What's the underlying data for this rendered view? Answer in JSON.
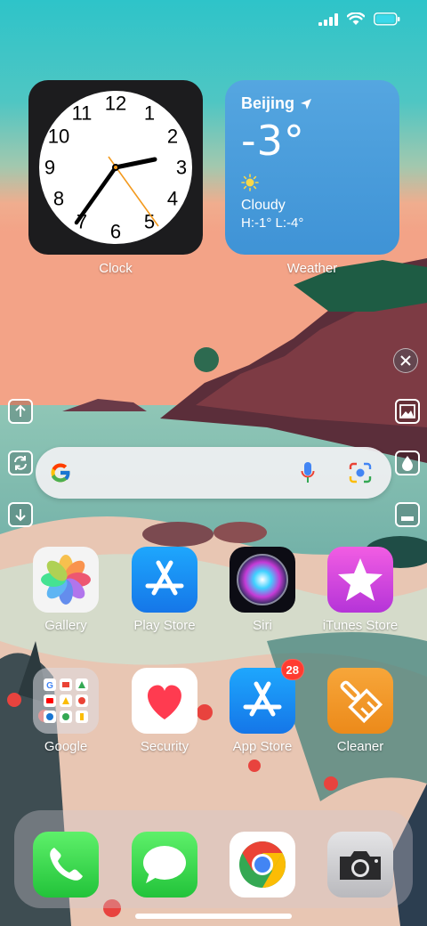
{
  "widgets": {
    "clock": {
      "label": "Clock",
      "numbers": [
        "12",
        "1",
        "2",
        "3",
        "4",
        "5",
        "6",
        "7",
        "8",
        "9",
        "10",
        "11"
      ]
    },
    "weather": {
      "label": "Weather",
      "city": "Beijing",
      "temperature": "-3°",
      "condition": "Cloudy",
      "hilo": "H:-1° L:-4°"
    }
  },
  "search": {
    "provider": "Google",
    "icons": [
      "google-g-icon",
      "microphone-icon",
      "lens-camera-icon"
    ]
  },
  "side_tools": [
    "arrow-up-icon",
    "rotate-icon",
    "arrow-down-icon",
    "image-icon",
    "water-drop-icon",
    "bottom-bar-icon",
    "close-icon"
  ],
  "apps_row1": [
    {
      "label": "Gallery",
      "icon": "photos-flower-icon"
    },
    {
      "label": "Play Store",
      "icon": "app-store-a-icon"
    },
    {
      "label": "Siri",
      "icon": "siri-orb-icon"
    },
    {
      "label": "iTunes Store",
      "icon": "star-icon"
    }
  ],
  "apps_row2": [
    {
      "label": "Google",
      "icon": "folder-icon"
    },
    {
      "label": "Security",
      "icon": "heart-icon"
    },
    {
      "label": "App Store",
      "icon": "app-store-a-icon",
      "badge": "28"
    },
    {
      "label": "Cleaner",
      "icon": "broom-icon"
    }
  ],
  "dock": [
    "phone-icon",
    "messages-icon",
    "chrome-icon",
    "camera-icon"
  ],
  "colors": {
    "accent_blue": "#1a8cf0",
    "badge_red": "#ff3b30",
    "weather_bg": "#4a9ddb"
  }
}
